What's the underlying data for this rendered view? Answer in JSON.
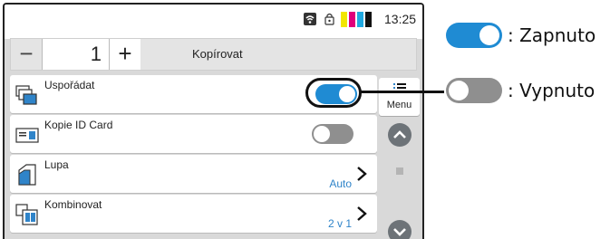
{
  "status": {
    "time": "13:25"
  },
  "toolbar": {
    "minus": "−",
    "copies": "1",
    "plus": "+",
    "mode": "Kopírovat"
  },
  "rows": [
    {
      "label": "Uspořádat",
      "value": "",
      "toggle": "on"
    },
    {
      "label": "Kopie ID Card",
      "value": "",
      "toggle": "off"
    },
    {
      "label": "Lupa",
      "value": "Auto"
    },
    {
      "label": "Kombinovat",
      "value": "2 v 1"
    }
  ],
  "side": {
    "menu_label": "Menu"
  },
  "legend": {
    "on_label": ": Zapnuto",
    "off_label": ": Vypnuto"
  },
  "colors": {
    "toggle_on": "#1f8bd3",
    "toggle_off": "#8f8f8f",
    "value_text": "#2f84c9"
  }
}
